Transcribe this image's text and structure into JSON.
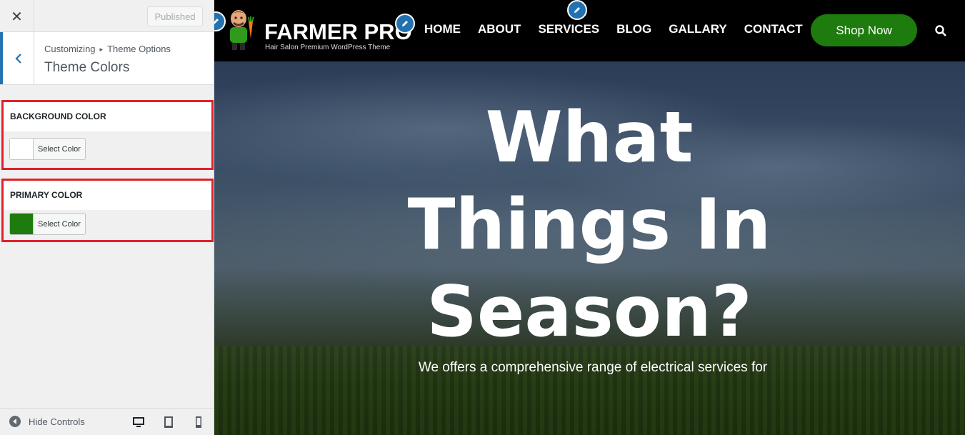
{
  "sidebar": {
    "published_label": "Published",
    "breadcrumb": {
      "parent": "Customizing",
      "current": "Theme Options"
    },
    "section_title": "Theme Colors",
    "controls": [
      {
        "label": "BACKGROUND COLOR",
        "button_label": "Select Color",
        "color": "#ffffff"
      },
      {
        "label": "PRIMARY COLOR",
        "button_label": "Select Color",
        "color": "#1e7b0d"
      }
    ],
    "footer": {
      "hide_controls_label": "Hide Controls"
    }
  },
  "site": {
    "logo_text": "FARMER PRO",
    "tagline": "Hair Salon Premium WordPress Theme",
    "nav": [
      "HOME",
      "ABOUT",
      "SERVICES",
      "BLOG",
      "GALLARY",
      "CONTACT"
    ],
    "shop_button": "Shop Now",
    "hero": {
      "title_lines": [
        "What",
        "Things In",
        "Season?"
      ],
      "subtitle": "We offers a comprehensive range of electrical services for"
    }
  },
  "colors": {
    "accent": "#2271b1",
    "highlight": "#e0202a",
    "brand_green": "#1e7b0d"
  },
  "icons": [
    "close-icon",
    "chevron-left-icon",
    "hide-controls-icon",
    "desktop-icon",
    "tablet-icon",
    "mobile-icon",
    "pencil-icon",
    "search-icon"
  ]
}
